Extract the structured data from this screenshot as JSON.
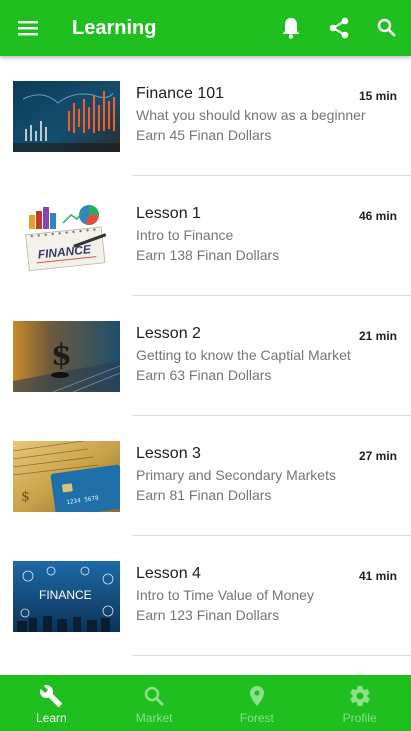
{
  "appbar": {
    "title": "Learning",
    "menu_icon": "menu-icon",
    "actions": [
      "bell-icon",
      "share-icon",
      "search-icon"
    ]
  },
  "lessons": [
    {
      "title": "Finance 101",
      "subtitle": "What you should know as a beginner",
      "reward": "Earn 45 Finan Dollars",
      "duration": "15 min",
      "image": "stock-chart-image"
    },
    {
      "title": "Lesson 1",
      "subtitle": "Intro to Finance",
      "reward": "Earn 138 Finan Dollars",
      "duration": "46 min",
      "image": "finance-notebook-image",
      "image_text": "FINANCE"
    },
    {
      "title": "Lesson 2",
      "subtitle": "Getting to know the Captial Market",
      "reward": "Earn 63 Finan Dollars",
      "duration": "21 min",
      "image": "dollar-chess-piece-image"
    },
    {
      "title": "Lesson 3",
      "subtitle": "Primary and Secondary Markets",
      "reward": "Earn 81 Finan Dollars",
      "duration": "27 min",
      "image": "cash-and-card-image"
    },
    {
      "title": "Lesson 4",
      "subtitle": "Intro to Time Value of Money",
      "reward": "Earn 123 Finan Dollars",
      "duration": "41 min",
      "image": "finance-icons-image",
      "image_text": "FINANCE"
    }
  ],
  "bottom_nav": [
    {
      "label": "Learn",
      "icon": "wrench-icon",
      "active": true
    },
    {
      "label": "Market",
      "icon": "search-icon",
      "active": false
    },
    {
      "label": "Forest",
      "icon": "location-pin-icon",
      "active": false
    },
    {
      "label": "Profile",
      "icon": "gear-icon",
      "active": false
    }
  ],
  "colors": {
    "primary": "#1ebf1e",
    "inactive_nav": "#8be08b",
    "subtitle": "#757575"
  }
}
